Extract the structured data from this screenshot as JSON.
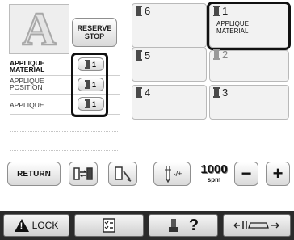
{
  "preview": {
    "letter": "A"
  },
  "reserve_stop": {
    "line1": "RESERVE",
    "line2": "STOP"
  },
  "materials": [
    {
      "label": "APPLIQUE MATERIAL",
      "needle": "1"
    },
    {
      "label": "APPLIQUE POSITION",
      "needle": "1"
    },
    {
      "label": "APPLIQUE",
      "needle": "1"
    }
  ],
  "needles": [
    {
      "number": "6",
      "text": ""
    },
    {
      "number": "1",
      "text": "APPLIQUE MATERIAL"
    },
    {
      "number": "5",
      "text": ""
    },
    {
      "number": "2",
      "text": ""
    },
    {
      "number": "4",
      "text": ""
    },
    {
      "number": "3",
      "text": ""
    }
  ],
  "controls": {
    "return_label": "RETURN",
    "needle_bar_label": "-/+",
    "speed_value": "1000",
    "speed_unit": "spm",
    "minus": "−",
    "plus": "+"
  },
  "bottom_bar": {
    "lock_label": "LOCK",
    "help_mark": "?"
  }
}
